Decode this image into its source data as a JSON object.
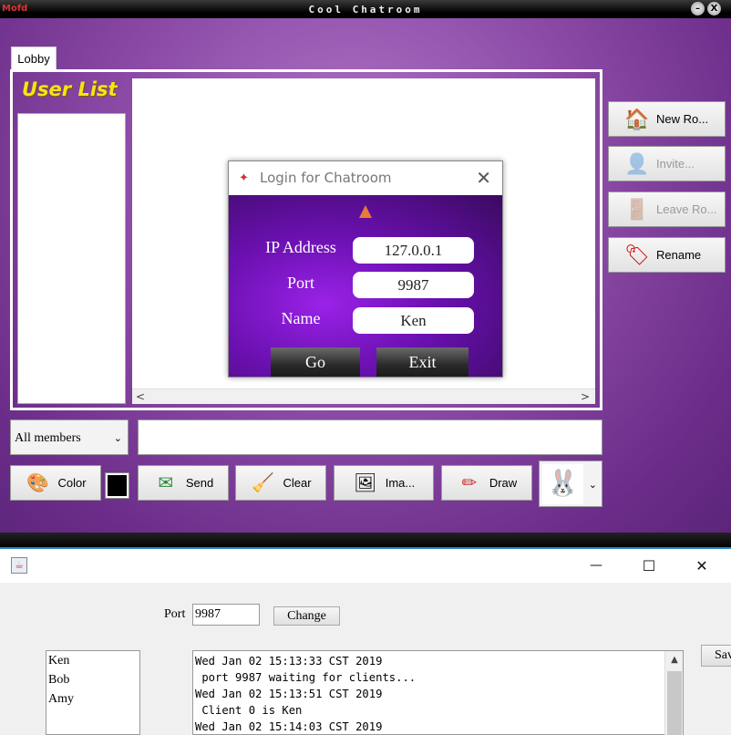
{
  "chat_window": {
    "title": "Cool Chatroom",
    "logo": "Mofd",
    "minimize_glyph": "–",
    "close_glyph": "X",
    "tab": "Lobby",
    "user_list_title": "User List",
    "side_buttons": [
      {
        "label": "New Ro...",
        "icon": "house-icon",
        "glyph": "🏠",
        "enabled": true
      },
      {
        "label": "Invite...",
        "icon": "invite-user-icon",
        "glyph": "👤",
        "enabled": false
      },
      {
        "label": "Leave Ro...",
        "icon": "door-icon",
        "glyph": "🚪",
        "enabled": false
      },
      {
        "label": "Rename",
        "icon": "tag-icon",
        "glyph": "🏷",
        "enabled": true
      }
    ],
    "recipient_select": "All members",
    "scroll_left": "<",
    "scroll_right": ">",
    "dropdown_arrow": "⌄",
    "toolbar": {
      "color": {
        "label": "Color",
        "icon": "paint-bucket-icon",
        "glyph": "🎨"
      },
      "color_value": "#000000",
      "send": {
        "label": "Send",
        "icon": "send-mail-icon",
        "glyph": "✉"
      },
      "clear": {
        "label": "Clear",
        "icon": "broom-icon",
        "glyph": "🧹"
      },
      "image": {
        "label": "Ima...",
        "icon": "image-icon",
        "glyph": "🖼"
      },
      "draw": {
        "label": "Draw",
        "icon": "pencil-icon",
        "glyph": "✏"
      },
      "emoji": {
        "icon": "rabbit-emoji-icon",
        "glyph": "🐰"
      }
    }
  },
  "login_dialog": {
    "title": "Login for Chatroom",
    "close_glyph": "✕",
    "ip_label": "IP Address",
    "ip_value": "127.0.0.1",
    "port_label": "Port",
    "port_value": "9987",
    "name_label": "Name",
    "name_value": "Ken",
    "go_label": "Go",
    "exit_label": "Exit"
  },
  "server_window": {
    "minimize_glyph": "—",
    "maximize_glyph": "☐",
    "close_glyph": "✕",
    "port_label": "Port",
    "port_value": "9987",
    "change_label": "Change",
    "save_label": "Save",
    "clients": [
      "Ken",
      "Bob",
      "Amy"
    ],
    "log": [
      "Wed Jan 02 15:13:33 CST 2019",
      " port 9987 waiting for clients...",
      "Wed Jan 02 15:13:51 CST 2019",
      " Client 0 is Ken",
      "Wed Jan 02 15:14:03 CST 2019"
    ]
  }
}
